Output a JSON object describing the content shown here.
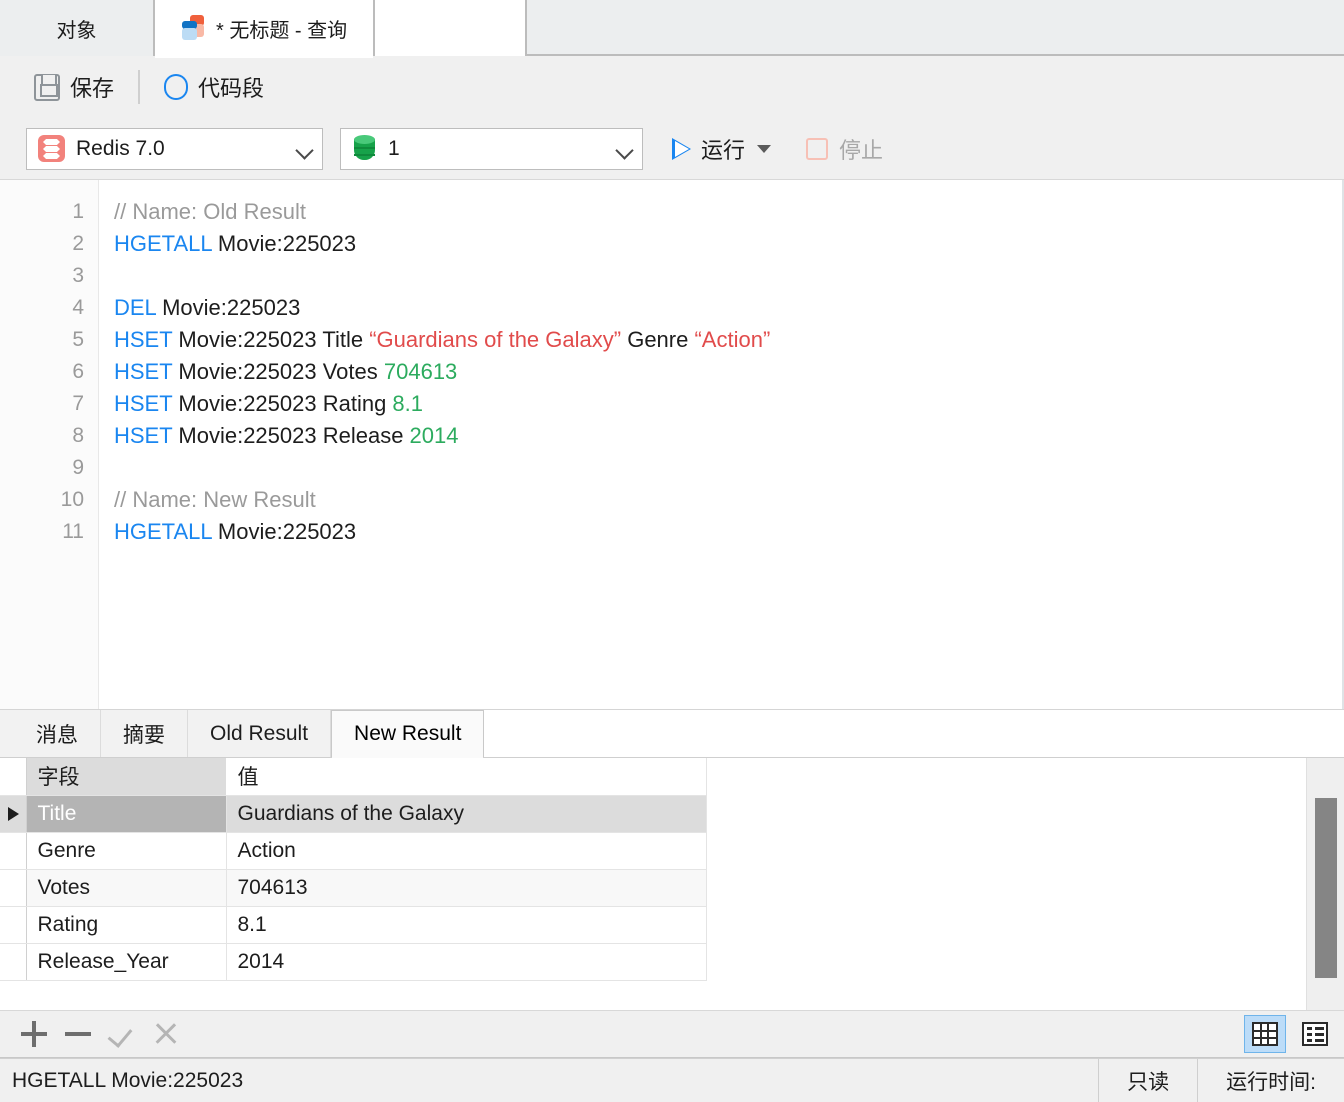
{
  "window_tabs": [
    {
      "label": "对象",
      "active": false,
      "icon": null
    },
    {
      "label": "* 无标题 - 查询",
      "active": true,
      "icon": "query-tab-icon"
    }
  ],
  "toolbar": {
    "save_label": "保存",
    "snippet_label": "代码段",
    "connection": {
      "value": "Redis 7.0",
      "icon": "redis-icon"
    },
    "database": {
      "value": "1",
      "icon": "database-icon"
    },
    "run_label": "运行",
    "stop_label": "停止"
  },
  "editor": {
    "line_numbers": [
      "1",
      "2",
      "3",
      "4",
      "5",
      "6",
      "7",
      "8",
      "9",
      "10",
      "11"
    ],
    "lines": [
      [
        {
          "t": "// Name: Old Result",
          "c": "cm"
        }
      ],
      [
        {
          "t": "HGETALL",
          "c": "kw"
        },
        {
          "t": " Movie:225023",
          "c": ""
        }
      ],
      [
        {
          "t": "",
          "c": ""
        }
      ],
      [
        {
          "t": "DEL",
          "c": "kw"
        },
        {
          "t": " Movie:225023",
          "c": ""
        }
      ],
      [
        {
          "t": "HSET",
          "c": "kw"
        },
        {
          "t": " Movie:225023 Title ",
          "c": ""
        },
        {
          "t": "“Guardians of the Galaxy”",
          "c": "st"
        },
        {
          "t": " Genre ",
          "c": ""
        },
        {
          "t": "“Action”",
          "c": "st"
        }
      ],
      [
        {
          "t": "HSET",
          "c": "kw"
        },
        {
          "t": " Movie:225023 Votes ",
          "c": ""
        },
        {
          "t": "704613",
          "c": "nm"
        }
      ],
      [
        {
          "t": "HSET",
          "c": "kw"
        },
        {
          "t": " Movie:225023 Rating ",
          "c": ""
        },
        {
          "t": "8.1",
          "c": "nm"
        }
      ],
      [
        {
          "t": "HSET",
          "c": "kw"
        },
        {
          "t": " Movie:225023 Release ",
          "c": ""
        },
        {
          "t": "2014",
          "c": "nm"
        }
      ],
      [
        {
          "t": "",
          "c": ""
        }
      ],
      [
        {
          "t": "// Name: New Result",
          "c": "cm"
        }
      ],
      [
        {
          "t": "HGETALL",
          "c": "kw"
        },
        {
          "t": " Movie:225023",
          "c": ""
        }
      ]
    ]
  },
  "result_tabs": [
    {
      "label": "消息",
      "active": false
    },
    {
      "label": "摘要",
      "active": false
    },
    {
      "label": "Old Result",
      "active": false
    },
    {
      "label": "New Result",
      "active": true
    }
  ],
  "result_grid": {
    "columns": [
      "字段",
      "值"
    ],
    "rows": [
      {
        "field": "Title",
        "value": "Guardians of the Galaxy",
        "selected": true
      },
      {
        "field": "Genre",
        "value": "Action",
        "selected": false
      },
      {
        "field": "Votes",
        "value": "704613",
        "selected": false
      },
      {
        "field": "Rating",
        "value": "8.1",
        "selected": false
      },
      {
        "field": "Release_Year",
        "value": "2014",
        "selected": false
      }
    ]
  },
  "grid_toolbar": {
    "add": "add-row-icon",
    "remove": "remove-row-icon",
    "confirm": "confirm-icon",
    "cancel": "cancel-icon",
    "view_grid": "grid-view-icon",
    "view_form": "form-view-icon"
  },
  "status_bar": {
    "query": "HGETALL Movie:225023",
    "readonly": "只读",
    "runtime": "运行时间:"
  },
  "colors": {
    "accent_blue": "#1a86f0",
    "keyword": "#1a86f0",
    "string": "#e14b4b",
    "number": "#2cab5e",
    "comment": "#9a9a9a",
    "redis_red": "#f2827c",
    "db_green": "#17a24a",
    "selection": "#b4b4b4"
  }
}
